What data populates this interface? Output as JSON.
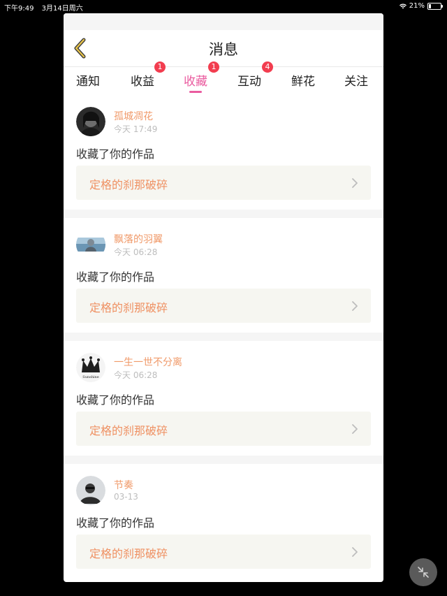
{
  "status": {
    "time": "下午9:49",
    "date": "3月14日周六",
    "battery": "21%",
    "battery_level": 0.21
  },
  "header": {
    "title": "消息",
    "back_icon": "chevron-left-icon"
  },
  "tabs": [
    {
      "label": "通知",
      "badge": null,
      "active": false
    },
    {
      "label": "收益",
      "badge": "1",
      "active": false
    },
    {
      "label": "收藏",
      "badge": "1",
      "active": true
    },
    {
      "label": "互动",
      "badge": "4",
      "active": false
    },
    {
      "label": "鲜花",
      "badge": null,
      "active": false
    },
    {
      "label": "关注",
      "badge": null,
      "active": false
    }
  ],
  "items": [
    {
      "user": "孤城凋花",
      "time": "今天 17:49",
      "action": "收藏了你的作品",
      "work": "定格的刹那破碎"
    },
    {
      "user": "飘落的羽翼",
      "time": "今天 06:28",
      "action": "收藏了你的作品",
      "work": "定格的刹那破碎"
    },
    {
      "user": "一生一世不分离",
      "time": "今天 06:28",
      "action": "收藏了你的作品",
      "work": "定格的刹那破碎",
      "avatar_text": "Sunshine"
    },
    {
      "user": "节奏",
      "time": "03-13",
      "action": "收藏了你的作品",
      "work": "定格的刹那破碎"
    }
  ],
  "colors": {
    "accent_pink": "#ea5b9f",
    "badge_red": "#f23d4f",
    "username_orange": "#f09a6a",
    "work_title_orange": "#ef9163"
  }
}
